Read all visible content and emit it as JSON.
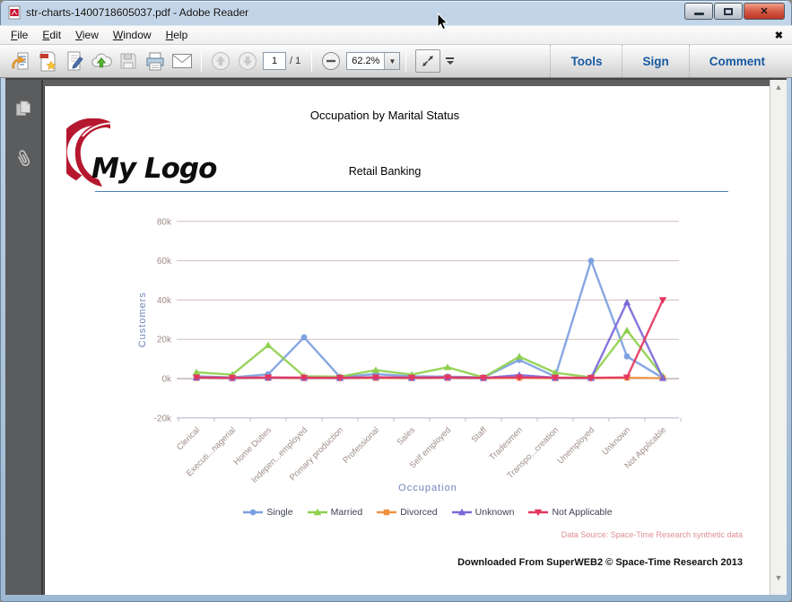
{
  "window": {
    "title": "str-charts-1400718605037.pdf - Adobe Reader"
  },
  "menu_bar": {
    "items": [
      {
        "label": "File"
      },
      {
        "label": "Edit"
      },
      {
        "label": "View"
      },
      {
        "label": "Window"
      },
      {
        "label": "Help"
      }
    ],
    "close_doc_glyph": "✖"
  },
  "toolbar": {
    "page_current": "1",
    "page_total": "/ 1",
    "zoom_level": "62.2%",
    "tools_label": "Tools",
    "sign_label": "Sign",
    "comment_label": "Comment"
  },
  "icons": {
    "titlebar": [
      "pdf-file-icon"
    ],
    "window_controls": [
      "minimize-icon",
      "maximize-icon",
      "close-icon"
    ],
    "toolbar": [
      "open-file-icon",
      "create-pdf-icon",
      "sign-document-icon",
      "cloud-upload-icon",
      "save-icon",
      "print-icon",
      "email-icon",
      "previous-page-icon",
      "next-page-icon",
      "zoom-out-icon",
      "zoom-dropdown-icon",
      "fit-window-icon",
      "toolbar-more-icon"
    ],
    "sidebar": [
      "page-thumbnails-icon",
      "attachments-icon"
    ],
    "scrollbar": [
      "scroll-up-icon",
      "scroll-down-icon"
    ]
  },
  "page": {
    "title": "Occupation by Marital Status",
    "subtitle": "Retail Banking",
    "logo_text": "My Logo",
    "data_source": "Data Source: Space-Time Research synthetic data",
    "download_note": "Downloaded From SuperWEB2 © Space-Time Research 2013"
  },
  "colors": {
    "accent_links": "#16599f",
    "page_rule": "#4a7ebb",
    "logo_red": "#b5182e",
    "grid": "#cfc0ba",
    "grid_zero": "#a3908a",
    "axis_line": "#b9b9d4",
    "axis_title_text": "#7086bb",
    "tick_text": "#9e8c86",
    "legend_text": "#3c4254",
    "data_source_text": "#dd8f93"
  },
  "chart_data": {
    "type": "line",
    "title": "Occupation by Marital Status",
    "xlabel": "Occupation",
    "ylabel": "Customers",
    "ylim": [
      -20000,
      80000
    ],
    "yticks": [
      80000,
      60000,
      40000,
      20000,
      0,
      -20000
    ],
    "ytick_labels": [
      "80k",
      "60k",
      "40k",
      "20k",
      "0k",
      "-20k"
    ],
    "grid": true,
    "legend_position": "bottom",
    "categories": [
      "Clerical",
      "Executi...nagerial",
      "Home Duties",
      "Indepen...employed",
      "Primary production",
      "Professional",
      "Sales",
      "Self employed",
      "Staff",
      "Tradesmen",
      "Transpo...creation",
      "Unemployed",
      "Unknown",
      "Not Applicable"
    ],
    "series": [
      {
        "name": "Single",
        "color": "#7da0e0",
        "marker": "circle",
        "values": [
          1200,
          600,
          2200,
          21000,
          800,
          2300,
          1200,
          1000,
          600,
          9500,
          1000,
          60000,
          11300,
          300
        ]
      },
      {
        "name": "Married",
        "color": "#8fd04e",
        "marker": "triangle",
        "values": [
          3200,
          2000,
          17000,
          1200,
          1000,
          4300,
          2000,
          5800,
          600,
          11200,
          3000,
          600,
          24500,
          1200
        ]
      },
      {
        "name": "Divorced",
        "color": "#ef9143",
        "marker": "square",
        "values": [
          300,
          200,
          300,
          200,
          200,
          300,
          200,
          300,
          200,
          400,
          200,
          200,
          500,
          200
        ]
      },
      {
        "name": "Unknown",
        "color": "#7b68d8",
        "marker": "triangle",
        "values": [
          500,
          300,
          500,
          400,
          300,
          700,
          400,
          500,
          300,
          1800,
          400,
          300,
          38800,
          300
        ]
      },
      {
        "name": "Not Applicable",
        "color": "#e5365f",
        "marker": "triangle-down",
        "values": [
          600,
          400,
          600,
          500,
          400,
          600,
          500,
          600,
          400,
          600,
          500,
          400,
          600,
          40000
        ]
      }
    ]
  }
}
